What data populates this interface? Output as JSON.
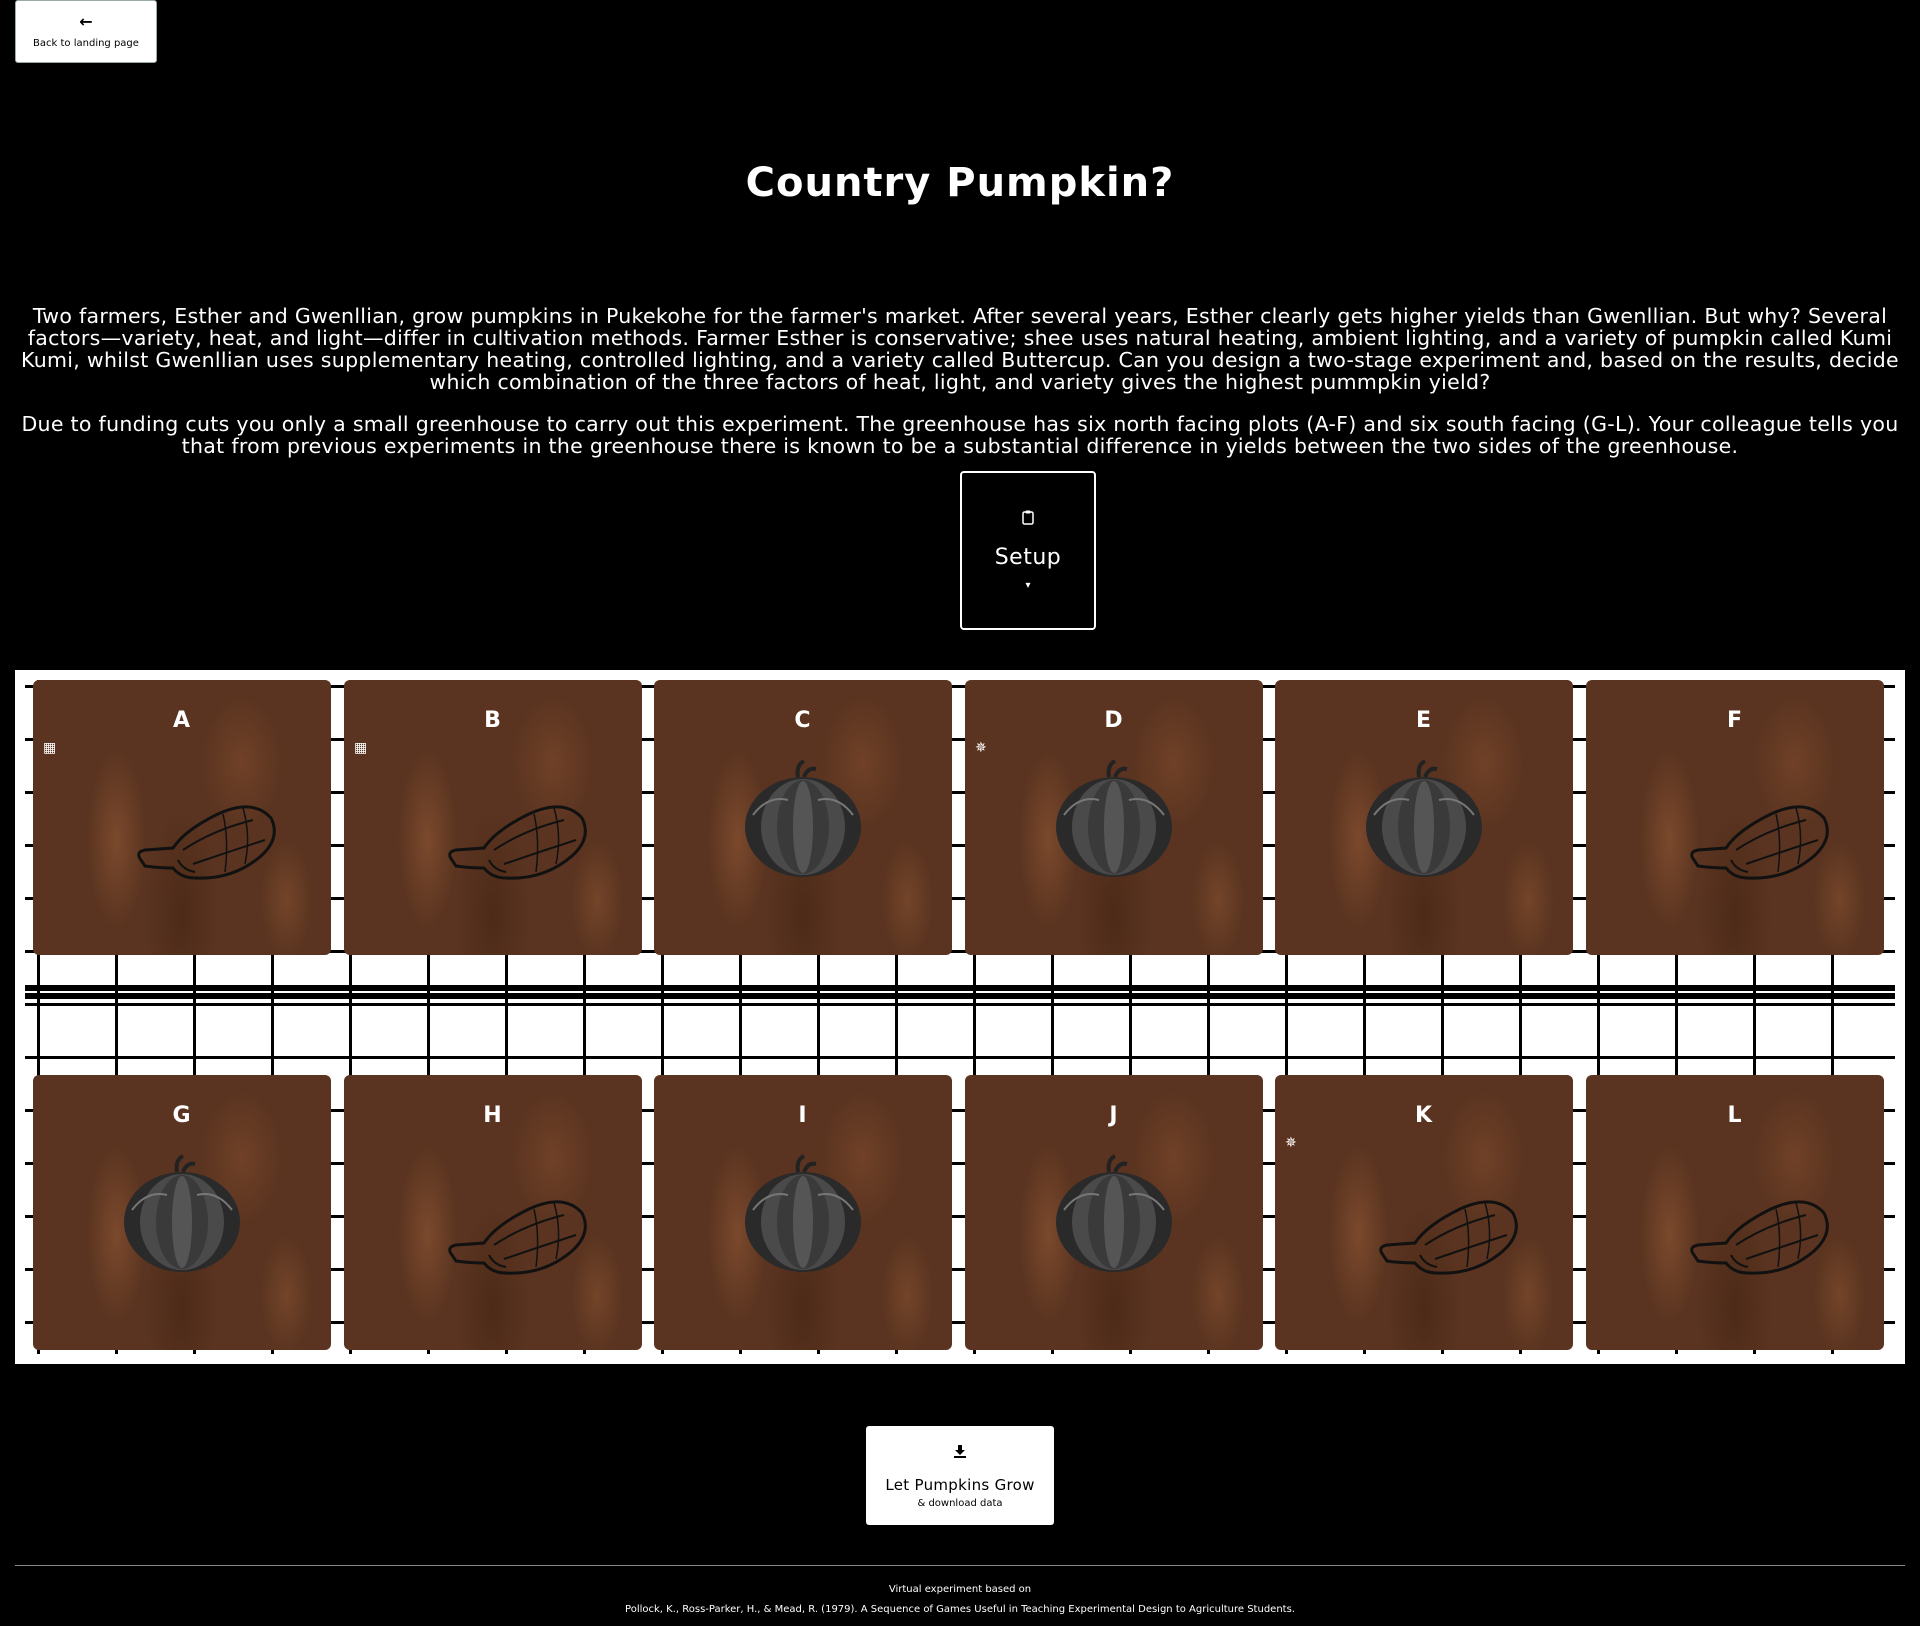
{
  "nav": {
    "back_icon": "arrow-left-icon",
    "back_label": "Back to landing page"
  },
  "title": "Country Pumpkin?",
  "intro": {
    "p1": "Two farmers, Esther and Gwenllian, grow pumpkins in Pukekohe for the farmer's market. After several years, Esther clearly gets higher yields than Gwenllian. But why? Several factors—variety, heat, and light—differ in cultivation methods. Farmer Esther is conservative; shee uses natural heating, ambient lighting, and a variety of pumpkin called Kumi Kumi, whilst Gwenllian uses supplementary heating, controlled lighting, and a variety called Buttercup. Can you design a two-stage experiment and, based on the results, decide which combination of the three factors of heat, light, and variety gives the highest pummpkin yield?",
    "p2": "Due to funding cuts you only a small greenhouse to carry out this experiment. The greenhouse has six north facing plots (A-F) and six south facing (G-L). Your colleague tells you that from previous experiments in the greenhouse there is known to be a substantial difference in yields between the two sides of the greenhouse."
  },
  "setup": {
    "icon": "clipboard-icon",
    "label": "Setup",
    "chevron": "▾"
  },
  "plots": [
    {
      "letter": "A",
      "variety": "kumi-kumi",
      "indicator": "solar-panel-icon"
    },
    {
      "letter": "B",
      "variety": "kumi-kumi",
      "indicator": "solar-panel-icon"
    },
    {
      "letter": "C",
      "variety": "buttercup",
      "indicator": ""
    },
    {
      "letter": "D",
      "variety": "buttercup",
      "indicator": "sun-icon"
    },
    {
      "letter": "E",
      "variety": "buttercup",
      "indicator": ""
    },
    {
      "letter": "F",
      "variety": "kumi-kumi",
      "indicator": ""
    },
    {
      "letter": "G",
      "variety": "buttercup",
      "indicator": ""
    },
    {
      "letter": "H",
      "variety": "kumi-kumi",
      "indicator": ""
    },
    {
      "letter": "I",
      "variety": "buttercup",
      "indicator": ""
    },
    {
      "letter": "J",
      "variety": "buttercup",
      "indicator": ""
    },
    {
      "letter": "K",
      "variety": "kumi-kumi",
      "indicator": "sun-icon"
    },
    {
      "letter": "L",
      "variety": "kumi-kumi",
      "indicator": ""
    }
  ],
  "grow": {
    "icon": "download-icon",
    "label": "Let Pumpkins Grow",
    "sublabel": "& download data"
  },
  "footer": {
    "line1": "Virtual experiment based on",
    "line2": "Pollock, K., Ross-Parker, H., & Mead, R. (1979). A Sequence of Games Useful in Teaching Experimental Design to Agriculture Students."
  },
  "colors": {
    "background": "#000000",
    "soil": "#5a3420",
    "text": "#ffffff"
  }
}
